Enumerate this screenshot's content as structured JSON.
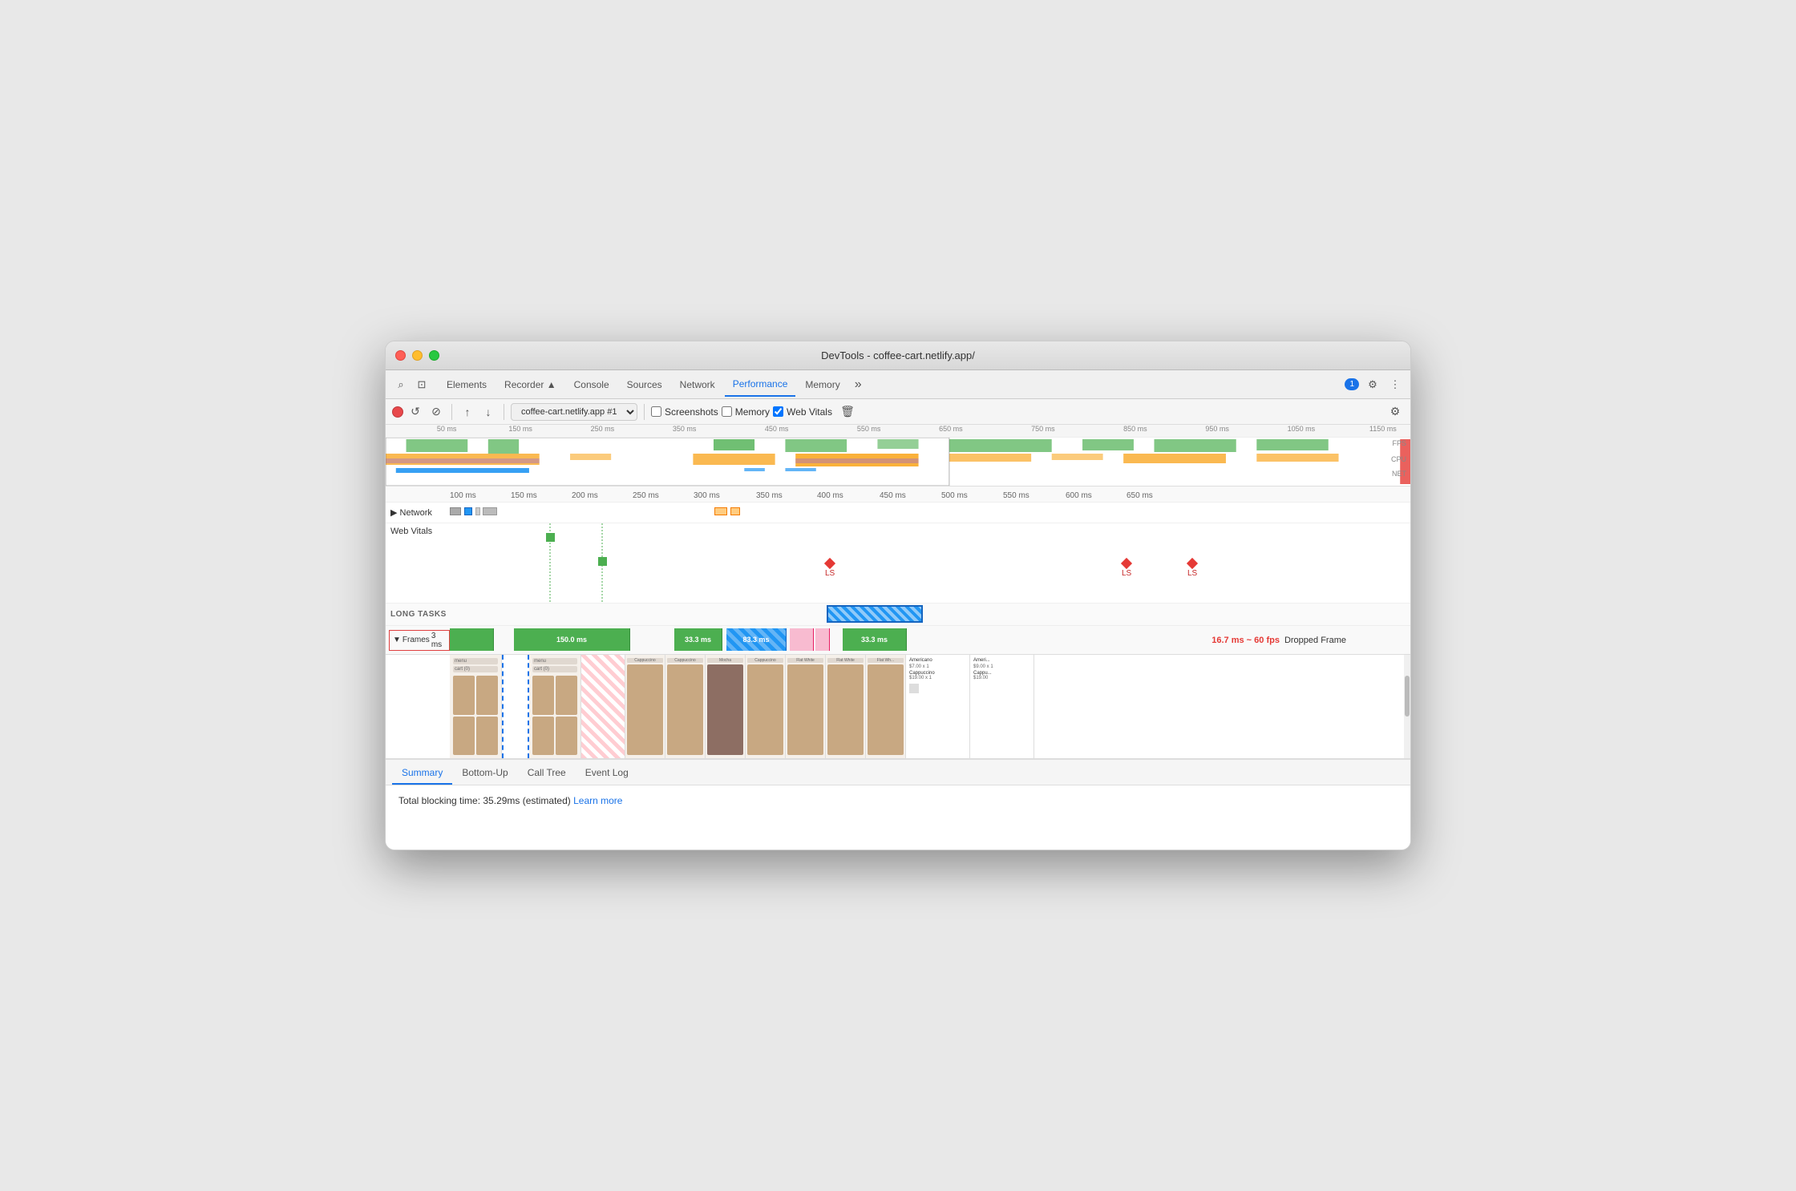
{
  "window": {
    "title": "DevTools - coffee-cart.netlify.app/"
  },
  "tabs": {
    "items": [
      "Elements",
      "Recorder ▲",
      "Console",
      "Sources",
      "Network",
      "Performance",
      "Memory",
      "»"
    ],
    "active": "Performance",
    "chat_badge": "1"
  },
  "toolbar": {
    "record_label": "●",
    "reload_label": "↺",
    "clear_label": "⊘",
    "upload_label": "↑",
    "download_label": "↓",
    "profile_select": "coffee-cart.netlify.app #1",
    "screenshots_label": "Screenshots",
    "memory_label": "Memory",
    "web_vitals_label": "Web Vitals",
    "clear_btn_label": "🗑"
  },
  "overview": {
    "marks": [
      "50 ms",
      "150 ms",
      "250 ms",
      "350 ms",
      "450 ms",
      "550 ms",
      "650 ms",
      "750 ms",
      "850 ms",
      "950 ms",
      "1050 ms",
      "1150 ms"
    ],
    "labels": {
      "fps": "FPS",
      "cpu": "CPU",
      "net": "NET"
    }
  },
  "timeline": {
    "ruler_marks": [
      "100 ms",
      "150 ms",
      "200 ms",
      "250 ms",
      "300 ms",
      "350 ms",
      "400 ms",
      "450 ms",
      "500 ms",
      "550 ms",
      "600 ms",
      "650 ms"
    ],
    "rows": {
      "network_label": "▶ Network",
      "web_vitals_label": "Web Vitals",
      "long_tasks_label": "LONG TASKS",
      "frames_label": "▼ Frames",
      "frames_time": "3 ms"
    },
    "frame_segments": [
      {
        "label": "",
        "width": "7%",
        "left": "0%",
        "type": "green"
      },
      {
        "label": "150.0 ms",
        "width": "18%",
        "left": "10%",
        "type": "green"
      },
      {
        "label": "33.3 ms",
        "width": "7%",
        "left": "33%",
        "type": "green"
      },
      {
        "label": "83.3 ms",
        "width": "9%",
        "left": "41%",
        "type": "blue-striped"
      },
      {
        "label": "33.3 ms",
        "width": "9%",
        "left": "57%",
        "type": "pink"
      }
    ],
    "dropped_frame": {
      "fps": "16.7 ms ~ 60 fps",
      "label": "Dropped Frame"
    },
    "ls_markers": [
      {
        "left": "38%",
        "label": "LS"
      },
      {
        "left": "82%",
        "label": "LS"
      },
      {
        "left": "88%",
        "label": "LS"
      }
    ]
  },
  "bottom": {
    "tabs": [
      "Summary",
      "Bottom-Up",
      "Call Tree",
      "Event Log"
    ],
    "active_tab": "Summary",
    "summary_text": "Total blocking time: 35.29ms (estimated)",
    "learn_more_label": "Learn more"
  }
}
